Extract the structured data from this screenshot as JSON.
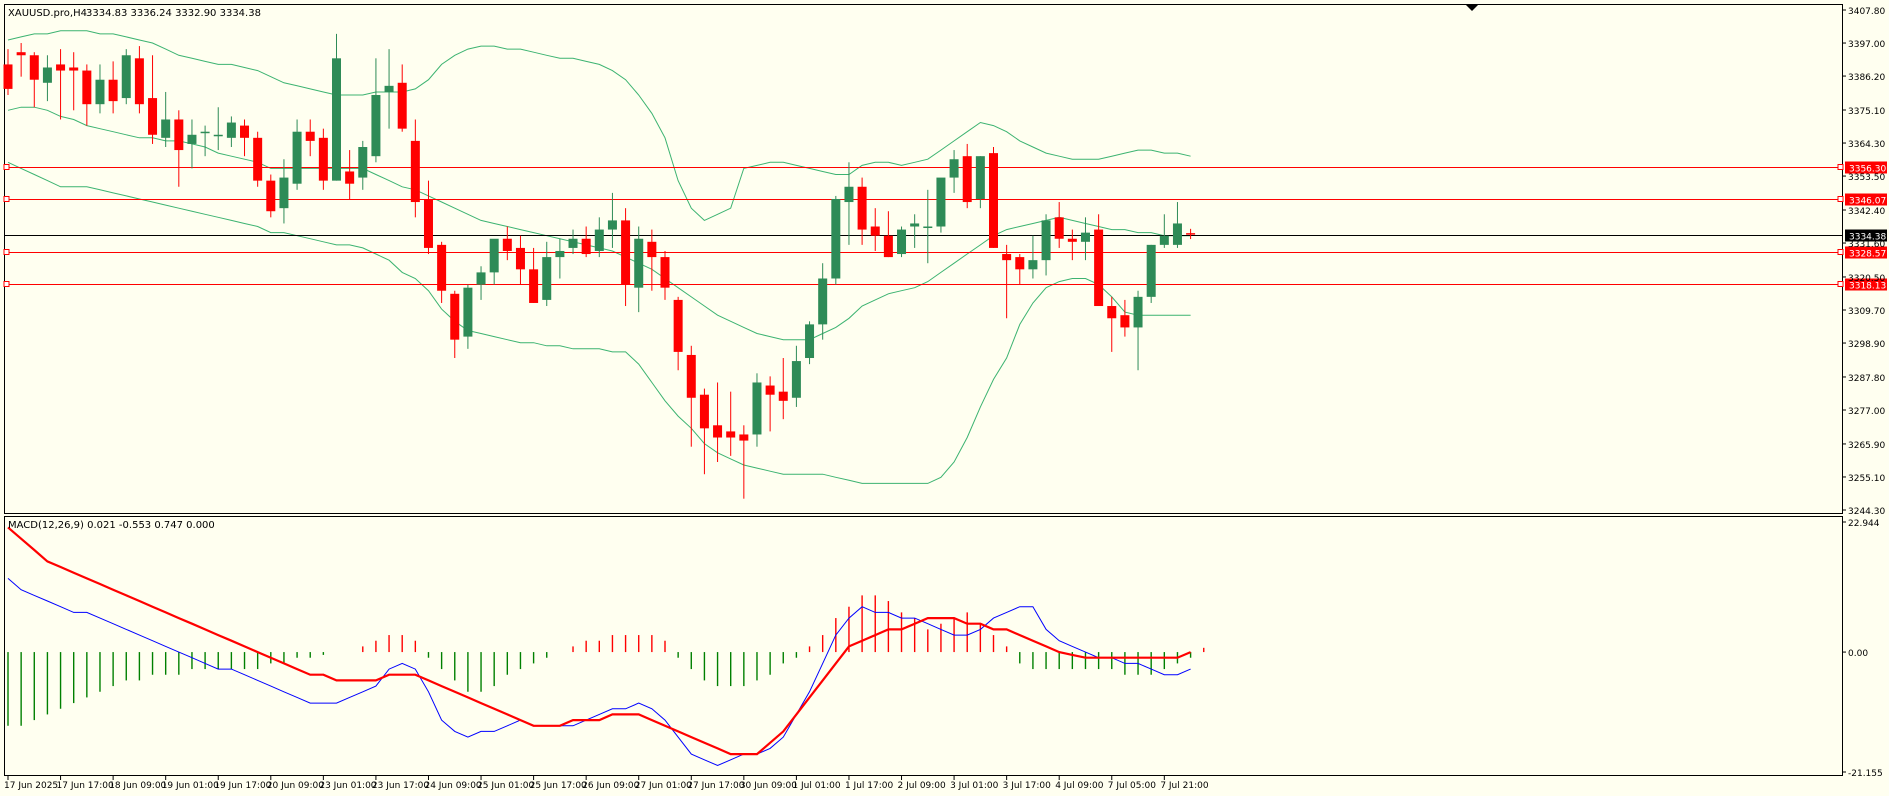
{
  "window": {
    "title": "XAUUSD.pro,H4",
    "ohlc": "3334.83 3336.24 3332.90 3334.38"
  },
  "indicator": {
    "title": "MACD(12,26,9) 0.021 -0.553 0.747 0.000"
  },
  "price_axis": {
    "labels": [
      "3407.80",
      "3397.00",
      "3386.20",
      "3375.10",
      "3364.30",
      "3353.50",
      "3342.40",
      "3331.60",
      "3320.50",
      "3309.70",
      "3298.90",
      "3287.80",
      "3277.00",
      "3265.90",
      "3255.10",
      "3244.30"
    ]
  },
  "macd_axis": {
    "labels": [
      "22.944",
      "0.00",
      "-21.155"
    ]
  },
  "time_axis": {
    "labels": [
      "17 Jun 2025",
      "17 Jun 17:00",
      "18 Jun 09:00",
      "19 Jun 01:00",
      "19 Jun 17:00",
      "20 Jun 09:00",
      "23 Jun 01:00",
      "23 Jun 17:00",
      "24 Jun 09:00",
      "25 Jun 01:00",
      "25 Jun 17:00",
      "26 Jun 09:00",
      "27 Jun 01:00",
      "27 Jun 17:00",
      "30 Jun 09:00",
      "1 Jul 01:00",
      "1 Jul 17:00",
      "2 Jul 09:00",
      "3 Jul 01:00",
      "3 Jul 17:00",
      "4 Jul 09:00",
      "7 Jul 05:00",
      "7 Jul 21:00"
    ]
  },
  "levels": [
    {
      "price": 3356.3,
      "label": "3356.30"
    },
    {
      "price": 3346.07,
      "label": "3346.07"
    },
    {
      "price": 3328.57,
      "label": "3328.57"
    },
    {
      "price": 3318.13,
      "label": "3318.13"
    }
  ],
  "current_price": {
    "price": 3334.38,
    "label": "3334.38"
  },
  "colors": {
    "bull": "#2e8b57",
    "bear": "#ff0000",
    "band": "#3cb371",
    "level": "#ff0000",
    "macd_hist_pos": "#ff0000",
    "macd_hist_neg": "#008000",
    "macd_line": "#0000ff",
    "signal_line": "#ff0000",
    "background": "#fffff0"
  },
  "chart_data": {
    "type": "candlestick",
    "symbol": "XAUUSD.pro",
    "timeframe": "H4",
    "ylim": [
      3244.3,
      3407.8
    ],
    "candles": [
      [
        3390,
        3395,
        3380,
        3382
      ],
      [
        3394,
        3397,
        3386,
        3393
      ],
      [
        3393,
        3394,
        3376,
        3385
      ],
      [
        3384,
        3393,
        3378,
        3389
      ],
      [
        3390,
        3395,
        3372,
        3388
      ],
      [
        3389,
        3394,
        3375,
        3388
      ],
      [
        3388,
        3390,
        3370,
        3377
      ],
      [
        3377,
        3390,
        3374,
        3385
      ],
      [
        3385,
        3391,
        3374,
        3378
      ],
      [
        3379,
        3395,
        3377,
        3393
      ],
      [
        3392,
        3396,
        3374,
        3377
      ],
      [
        3379,
        3393,
        3364,
        3367
      ],
      [
        3366,
        3381,
        3363,
        3372
      ],
      [
        3372,
        3375,
        3350,
        3362
      ],
      [
        3364,
        3372,
        3356,
        3367
      ],
      [
        3368,
        3370,
        3360,
        3368
      ],
      [
        3367,
        3376,
        3362,
        3367
      ],
      [
        3366,
        3373,
        3363,
        3371
      ],
      [
        3370,
        3372,
        3360,
        3366
      ],
      [
        3366,
        3368,
        3350,
        3352
      ],
      [
        3352,
        3354,
        3340,
        3342
      ],
      [
        3343,
        3359,
        3338,
        3353
      ],
      [
        3351,
        3372,
        3349,
        3368
      ],
      [
        3368,
        3372,
        3360,
        3365
      ],
      [
        3366,
        3369,
        3349,
        3352
      ],
      [
        3352,
        3400,
        3352,
        3392
      ],
      [
        3355,
        3362,
        3346,
        3351
      ],
      [
        3353,
        3365,
        3349,
        3363
      ],
      [
        3360,
        3392,
        3358,
        3380
      ],
      [
        3381,
        3395,
        3369,
        3383
      ],
      [
        3384,
        3390,
        3368,
        3369
      ],
      [
        3365,
        3372,
        3340,
        3345
      ],
      [
        3346,
        3352,
        3328,
        3330
      ],
      [
        3331,
        3332,
        3312,
        3316
      ],
      [
        3315,
        3316,
        3294,
        3300
      ],
      [
        3301,
        3318,
        3297,
        3317
      ],
      [
        3318,
        3324,
        3313,
        3322
      ],
      [
        3322,
        3330,
        3318,
        3333
      ],
      [
        3333,
        3337,
        3326,
        3329
      ],
      [
        3330,
        3334,
        3318,
        3323
      ],
      [
        3323,
        3330,
        3312,
        3312
      ],
      [
        3313,
        3332,
        3311,
        3327
      ],
      [
        3327,
        3333,
        3320,
        3329
      ],
      [
        3330,
        3336,
        3328,
        3333
      ],
      [
        3333,
        3337,
        3327,
        3328
      ],
      [
        3329,
        3340,
        3327,
        3336
      ],
      [
        3336,
        3348,
        3330,
        3339
      ],
      [
        3339,
        3343,
        3311,
        3318
      ],
      [
        3317,
        3337,
        3309,
        3333
      ],
      [
        3332,
        3336,
        3316,
        3327
      ],
      [
        3327,
        3329,
        3313,
        3317
      ],
      [
        3313,
        3314,
        3290,
        3296
      ],
      [
        3295,
        3298,
        3265,
        3281
      ],
      [
        3282,
        3284,
        3256,
        3271
      ],
      [
        3272,
        3286,
        3260,
        3268
      ],
      [
        3270,
        3283,
        3262,
        3268
      ],
      [
        3269,
        3272,
        3248,
        3267
      ],
      [
        3269,
        3289,
        3265,
        3286
      ],
      [
        3285,
        3288,
        3270,
        3282
      ],
      [
        3283,
        3294,
        3274,
        3280
      ],
      [
        3281,
        3298,
        3278,
        3293
      ],
      [
        3294,
        3306,
        3292,
        3305
      ],
      [
        3305,
        3325,
        3300,
        3320
      ],
      [
        3320,
        3347,
        3318,
        3346
      ],
      [
        3345,
        3358,
        3331,
        3350
      ],
      [
        3350,
        3353,
        3331,
        3336
      ],
      [
        3337,
        3343,
        3329,
        3334
      ],
      [
        3334,
        3342,
        3327,
        3327
      ],
      [
        3328,
        3337,
        3327,
        3336
      ],
      [
        3337,
        3341,
        3330,
        3338
      ],
      [
        3337,
        3349,
        3325,
        3337
      ],
      [
        3337,
        3351,
        3335,
        3353
      ],
      [
        3353,
        3362,
        3348,
        3359
      ],
      [
        3360,
        3364,
        3343,
        3345
      ],
      [
        3346,
        3360,
        3343,
        3360
      ],
      [
        3361,
        3363,
        3330,
        3330
      ],
      [
        3328,
        3331,
        3307,
        3326
      ],
      [
        3327,
        3328,
        3318,
        3323
      ],
      [
        3323,
        3334,
        3320,
        3326
      ],
      [
        3326,
        3341,
        3321,
        3339
      ],
      [
        3340,
        3345,
        3330,
        3333
      ],
      [
        3333,
        3336,
        3326,
        3332
      ],
      [
        3332,
        3340,
        3326,
        3335
      ],
      [
        3336,
        3341,
        3325,
        3311
      ],
      [
        3311,
        3314,
        3296,
        3307
      ],
      [
        3308,
        3313,
        3301,
        3304
      ],
      [
        3304,
        3316,
        3290,
        3314
      ],
      [
        3314,
        3331,
        3312,
        3331
      ],
      [
        3331,
        3341,
        3330,
        3334
      ],
      [
        3331,
        3345,
        3330,
        3338
      ],
      [
        3334.83,
        3336.24,
        3332.9,
        3334.38
      ]
    ],
    "bands": {
      "upper": [
        3398,
        3399,
        3400,
        3400,
        3401,
        3401,
        3401,
        3400,
        3400,
        3399,
        3398,
        3397,
        3395,
        3393,
        3392,
        3391,
        3390,
        3390,
        3389,
        3388,
        3386,
        3384,
        3383,
        3382,
        3381,
        3380,
        3380,
        3380,
        3381,
        3381,
        3381,
        3382,
        3385,
        3390,
        3393,
        3395,
        3396,
        3396,
        3395,
        3395,
        3394,
        3393,
        3392,
        3392,
        3391,
        3390,
        3388,
        3385,
        3380,
        3374,
        3366,
        3352,
        3343,
        3339,
        3341,
        3343,
        3356,
        3357,
        3358,
        3358,
        3357,
        3356,
        3355,
        3354,
        3354,
        3357,
        3358,
        3358,
        3357,
        3358,
        3359,
        3362,
        3365,
        3368,
        3371,
        3370,
        3368,
        3365,
        3363,
        3361,
        3360,
        3359,
        3359,
        3359,
        3360,
        3361,
        3362,
        3362,
        3361,
        3361,
        3360
      ],
      "middle": [
        3375,
        3376,
        3376,
        3375,
        3373,
        3372,
        3370,
        3369,
        3368,
        3367,
        3366,
        3366,
        3365,
        3365,
        3364,
        3363,
        3361,
        3360,
        3359,
        3358,
        3356,
        3356,
        3356,
        3356,
        3356,
        3356,
        3356,
        3356,
        3354,
        3352,
        3350,
        3349,
        3347,
        3345,
        3343,
        3341,
        3339,
        3338,
        3337,
        3336,
        3335,
        3334,
        3333,
        3332,
        3331,
        3330,
        3329,
        3327,
        3325,
        3323,
        3320,
        3317,
        3314,
        3311,
        3308,
        3306,
        3304,
        3302,
        3301,
        3300,
        3300,
        3300,
        3302,
        3304,
        3307,
        3311,
        3313,
        3315,
        3316,
        3317,
        3319,
        3322,
        3325,
        3328,
        3331,
        3334,
        3336,
        3337,
        3338,
        3339,
        3340,
        3339,
        3338,
        3337,
        3336,
        3336,
        3335,
        3335,
        3334,
        3334,
        3334
      ],
      "lower": [
        3358,
        3356,
        3354,
        3352,
        3350,
        3350,
        3350,
        3349,
        3348,
        3347,
        3346,
        3345,
        3344,
        3343,
        3342,
        3341,
        3340,
        3339,
        3338,
        3337,
        3335,
        3335,
        3334,
        3333,
        3332,
        3331,
        3331,
        3330,
        3328,
        3326,
        3322,
        3320,
        3316,
        3310,
        3306,
        3303,
        3302,
        3301,
        3300,
        3299,
        3299,
        3298,
        3298,
        3297,
        3297,
        3297,
        3296,
        3296,
        3292,
        3286,
        3280,
        3275,
        3271,
        3266,
        3263,
        3261,
        3259,
        3258,
        3257,
        3256,
        3256,
        3256,
        3256,
        3255,
        3254,
        3253,
        3253,
        3253,
        3253,
        3253,
        3253,
        3255,
        3260,
        3268,
        3278,
        3287,
        3294,
        3305,
        3312,
        3317,
        3319,
        3320,
        3320,
        3318,
        3314,
        3309,
        3308,
        3308,
        3308,
        3308,
        3308
      ]
    },
    "macd": {
      "ylim": [
        -21.155,
        22.944
      ],
      "histogram": [
        -13,
        -13,
        -12,
        -11,
        -10,
        -9,
        -8,
        -7,
        -6,
        -5,
        -5,
        -4,
        -4,
        -4,
        -3,
        -3,
        -3,
        -3,
        -3,
        -3,
        -2,
        -2,
        -1,
        -1,
        -0.5,
        0,
        0,
        1,
        2,
        3,
        3,
        2,
        -1,
        -3,
        -5,
        -7,
        -7,
        -6,
        -4,
        -3,
        -2,
        -1,
        0,
        1,
        2,
        2,
        3,
        3,
        3,
        3,
        2,
        -1,
        -3,
        -5,
        -6,
        -6,
        -6,
        -5,
        -4,
        -2,
        -1,
        1,
        3,
        6,
        8,
        10,
        10,
        9,
        7,
        6,
        4,
        5,
        6,
        7,
        5,
        3,
        1,
        -2,
        -3,
        -3,
        -3,
        -3,
        -3,
        -3,
        -3,
        -4,
        -4,
        -4,
        -3,
        -2,
        -1,
        0.75
      ],
      "macd_line": [
        13,
        11,
        10,
        9,
        8,
        7,
        7,
        6,
        5,
        4,
        3,
        2,
        1,
        0,
        -1,
        -2,
        -3,
        -3,
        -4,
        -5,
        -6,
        -7,
        -8,
        -9,
        -9,
        -9,
        -8,
        -7,
        -6,
        -3,
        -2,
        -3,
        -7,
        -12,
        -14,
        -15,
        -14,
        -14,
        -13,
        -12,
        -13,
        -13,
        -13,
        -13,
        -12,
        -11,
        -10,
        -10,
        -9,
        -10,
        -12,
        -15,
        -18,
        -19,
        -20,
        -19,
        -18,
        -18,
        -17,
        -15,
        -11,
        -7,
        -2,
        3,
        6,
        8,
        7,
        7,
        6,
        6,
        5,
        4,
        3,
        3,
        4,
        6,
        7,
        8,
        8,
        4,
        2,
        1,
        0,
        -1,
        -1,
        -2,
        -2,
        -3,
        -4,
        -4,
        -3
      ],
      "signal_line": [
        22,
        20,
        18,
        16,
        15,
        14,
        13,
        12,
        11,
        10,
        9,
        8,
        7,
        6,
        5,
        4,
        3,
        2,
        1,
        0,
        -1,
        -2,
        -3,
        -4,
        -4,
        -5,
        -5,
        -5,
        -5,
        -4,
        -4,
        -4,
        -5,
        -6,
        -7,
        -8,
        -9,
        -10,
        -11,
        -12,
        -13,
        -13,
        -13,
        -12,
        -12,
        -12,
        -11,
        -11,
        -11,
        -12,
        -13,
        -14,
        -15,
        -16,
        -17,
        -18,
        -18,
        -18,
        -16,
        -14,
        -11,
        -8,
        -5,
        -2,
        1,
        2,
        3,
        4,
        4,
        5,
        6,
        6,
        6,
        5,
        5,
        4,
        4,
        3,
        2,
        1,
        0,
        -0.5,
        -1,
        -1,
        -1,
        -1,
        -1,
        -1,
        -1,
        -1,
        0
      ]
    }
  }
}
